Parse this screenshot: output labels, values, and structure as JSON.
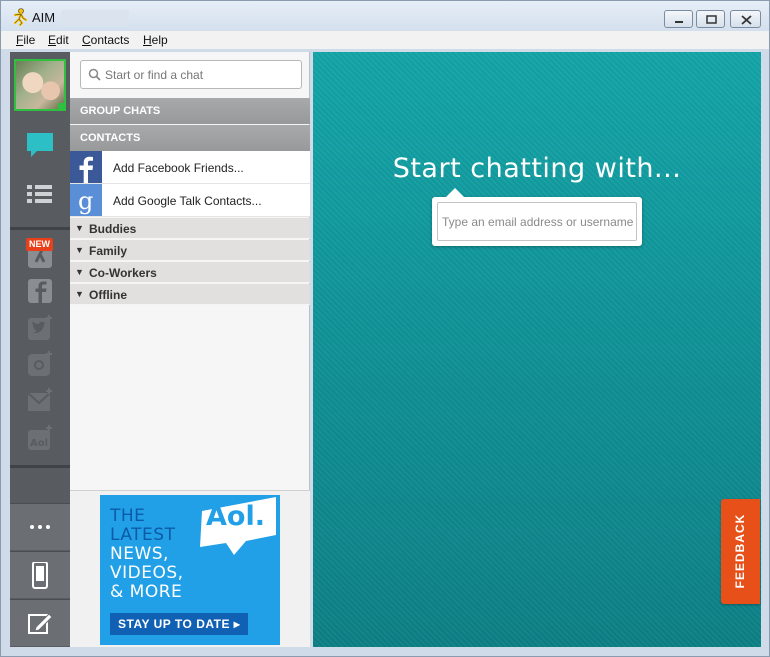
{
  "window": {
    "title": "AIM"
  },
  "menu": [
    "File",
    "Edit",
    "Contacts",
    "Help"
  ],
  "rail": {
    "new_badge": "NEW",
    "icons": [
      "chat-icon",
      "contacts-list-icon",
      "aim-running-man-icon",
      "facebook-icon",
      "twitter-add-icon",
      "instagram-add-icon",
      "email-add-icon",
      "aol-add-icon"
    ],
    "bottom_buttons": [
      "more-icon",
      "mobile-icon",
      "compose-icon"
    ],
    "status_color": "#30c040"
  },
  "search": {
    "placeholder": "Start or find a chat"
  },
  "sections": {
    "group_chats": "GROUP CHATS",
    "contacts": "CONTACTS"
  },
  "add_rows": [
    {
      "label": "Add Facebook Friends...",
      "icon": "facebook-logo"
    },
    {
      "label": "Add Google Talk Contacts...",
      "icon": "google-logo"
    }
  ],
  "groups": [
    "Buddies",
    "Family",
    "Co-Workers",
    "Offline"
  ],
  "ad": {
    "logo": "Aol.",
    "lines": [
      "THE",
      "LATEST",
      "NEWS,",
      "VIDEOS,",
      "& MORE"
    ],
    "button": "STAY UP TO DATE ▸"
  },
  "main": {
    "title": "Start chatting with...",
    "input_placeholder": "Type an email address or username",
    "feedback": "FEEDBACK",
    "bg_color": "#12999d",
    "feedback_color": "#e8501a"
  }
}
